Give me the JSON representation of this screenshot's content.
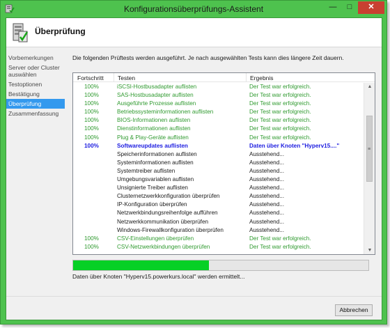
{
  "window": {
    "title": "Konfigurationsüberprüfungs-Assistent",
    "minimize_glyph": "—",
    "maximize_glyph": "□",
    "close_glyph": "✕"
  },
  "header": {
    "title": "Überprüfung"
  },
  "nav": {
    "items": [
      {
        "label": "Vorbemerkungen",
        "active": false
      },
      {
        "label": "Server oder Cluster auswählen",
        "active": false
      },
      {
        "label": "Testoptionen",
        "active": false
      },
      {
        "label": "Bestätigung",
        "active": false
      },
      {
        "label": "Überprüfung",
        "active": true
      },
      {
        "label": "Zusammenfassung",
        "active": false
      }
    ]
  },
  "main": {
    "intro": "Die folgenden Prüftests werden ausgeführt. Je nach ausgewählten Tests kann dies längere Zeit dauern."
  },
  "table": {
    "columns": {
      "progress": "Fortschritt",
      "test": "Testen",
      "result": "Ergebnis"
    },
    "rows": [
      {
        "state": "ok",
        "progress": "100%",
        "test": "iSCSI-Hostbusadapter auflisten",
        "result": "Der Test war erfolgreich."
      },
      {
        "state": "ok",
        "progress": "100%",
        "test": "SAS-Hostbusadapter auflisten",
        "result": "Der Test war erfolgreich."
      },
      {
        "state": "ok",
        "progress": "100%",
        "test": "Ausgeführte Prozesse auflisten",
        "result": "Der Test war erfolgreich."
      },
      {
        "state": "ok",
        "progress": "100%",
        "test": "Betriebssysteminformationen auflisten",
        "result": "Der Test war erfolgreich."
      },
      {
        "state": "ok",
        "progress": "100%",
        "test": "BIOS-Informationen auflisten",
        "result": "Der Test war erfolgreich."
      },
      {
        "state": "ok",
        "progress": "100%",
        "test": "Dienstinformationen auflisten",
        "result": "Der Test war erfolgreich."
      },
      {
        "state": "ok",
        "progress": "100%",
        "test": "Plug & Play-Geräte auflisten",
        "result": "Der Test war erfolgreich."
      },
      {
        "state": "cur",
        "progress": "100%",
        "test": "Softwareupdates auflisten",
        "result": "Daten über Knoten \"Hyperv15....\""
      },
      {
        "state": "run",
        "progress": "",
        "test": "Speicherinformationen auflisten",
        "result": "Ausstehend..."
      },
      {
        "state": "run",
        "progress": "",
        "test": "Systeminformationen auflisten",
        "result": "Ausstehend..."
      },
      {
        "state": "run",
        "progress": "",
        "test": "Systemtreiber auflisten",
        "result": "Ausstehend..."
      },
      {
        "state": "run",
        "progress": "",
        "test": "Umgebungsvariablen auflisten",
        "result": "Ausstehend..."
      },
      {
        "state": "run",
        "progress": "",
        "test": "Unsignierte Treiber auflisten",
        "result": "Ausstehend..."
      },
      {
        "state": "run",
        "progress": "",
        "test": "Clusternetzwerkkonfiguration überprüfen",
        "result": "Ausstehend..."
      },
      {
        "state": "run",
        "progress": "",
        "test": "IP-Konfiguration überprüfen",
        "result": "Ausstehend..."
      },
      {
        "state": "run",
        "progress": "",
        "test": "Netzwerkbindungsreihenfolge aufführen",
        "result": "Ausstehend..."
      },
      {
        "state": "run",
        "progress": "",
        "test": "Netzwerkkommunikation überprüfen",
        "result": "Ausstehend..."
      },
      {
        "state": "run",
        "progress": "",
        "test": "Windows-Firewallkonfiguration überprüfen",
        "result": "Ausstehend..."
      },
      {
        "state": "ok",
        "progress": "100%",
        "test": "CSV-Einstellungen überprüfen",
        "result": "Der Test war erfolgreich."
      },
      {
        "state": "ok",
        "progress": "100%",
        "test": "CSV-Netzwerkbindungen überprüfen",
        "result": "Der Test war erfolgreich."
      }
    ]
  },
  "progress": {
    "fraction": 0.46
  },
  "status": "Daten über Knoten \"Hyperv15.powerkurs.local\" werden ermittelt...",
  "buttons": {
    "cancel": "Abbrechen"
  },
  "colors": {
    "accent": "#4ec24e",
    "progress_fill": "#06d025",
    "success_text": "#2f9a2f",
    "active_text": "#1c1ce0",
    "selection": "#3399ee"
  },
  "icons": {
    "app": "wizard-icon",
    "header": "server-check-icon",
    "scroll_up": "arrow-up-icon",
    "scroll_down": "arrow-down-icon",
    "grip": "grip-icon"
  }
}
